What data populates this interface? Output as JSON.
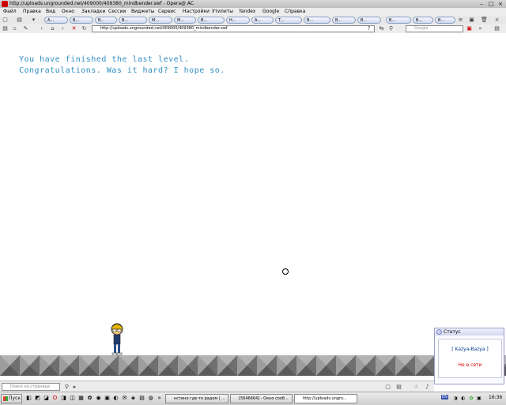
{
  "window": {
    "title": "http://uploads.ungrounded.net/409000/409380_mindbender.swf - Opera@ AC"
  },
  "menu": [
    "Файл",
    "Правка",
    "Вид",
    "Окно",
    "Закладки",
    "Сессии",
    "Виджеты",
    "Сервис",
    "Настройки",
    "Утилиты",
    "Yandex",
    "Google",
    "Справка"
  ],
  "tabs": [
    "A...",
    "B...",
    "B...",
    "B...",
    "M...",
    "M...",
    "B...",
    "H...",
    "A...",
    "T...",
    "B...",
    "B...",
    "B...",
    "B...",
    "B...",
    "B...",
    "B...",
    "B...",
    "B..."
  ],
  "address": {
    "url": "http://uploads.ungrounded.net/409000/409380_mindbender.swf",
    "search_placeholder": "Google"
  },
  "game": {
    "line1": "You have finished the last level.",
    "line2": "Congratulations. Was it hard? I hope so."
  },
  "status_popup": {
    "title": "Статус",
    "name": "[ Kazya-Bazya ]",
    "state": "Не в сети"
  },
  "findbar": {
    "placeholder": "Поиск на странице"
  },
  "taskbar": {
    "start": "Пуск",
    "tasks": [
      {
        "label": "нстино где-то радом | ...",
        "active": false
      },
      {
        "label": "[5646664] - Окно сооб...",
        "active": false
      },
      {
        "label": "http://uploads.ungro...",
        "active": true
      }
    ],
    "lang": "EN",
    "time": "16:36"
  },
  "colors": {
    "message_text": "#2f8fc4",
    "status_offline": "#dd0000"
  }
}
